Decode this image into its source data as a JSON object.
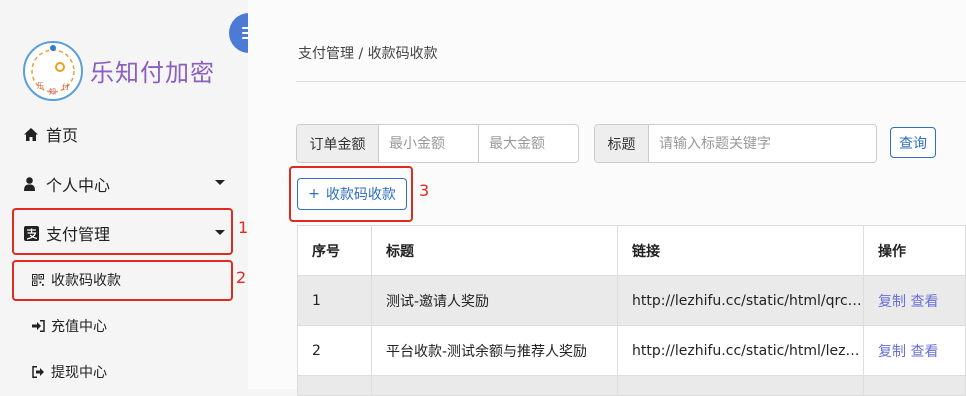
{
  "brand": {
    "name": "乐知付加密",
    "logo_text": [
      "乐",
      "知",
      "付"
    ]
  },
  "sidebar": {
    "items": [
      {
        "label": "首页",
        "icon": "home-icon"
      },
      {
        "label": "个人中心",
        "icon": "user-icon"
      },
      {
        "label": "支付管理",
        "icon": "alipay-icon"
      }
    ],
    "sub_items": [
      {
        "label": "收款码收款",
        "icon": "qrcode-icon"
      },
      {
        "label": "充值中心",
        "icon": "sign-in-icon"
      },
      {
        "label": "提现中心",
        "icon": "sign-out-icon"
      }
    ]
  },
  "annotations": [
    "1",
    "2",
    "3"
  ],
  "breadcrumb": "支付管理 / 收款码收款",
  "filters": {
    "amount_label": "订单金额",
    "min_placeholder": "最小金额",
    "max_placeholder": "最大金额",
    "title_label": "标题",
    "title_placeholder": "请输入标题关键字",
    "query_label": "查询"
  },
  "add_button": {
    "icon": "+",
    "label": "收款码收款"
  },
  "table": {
    "headers": [
      "序号",
      "标题",
      "链接",
      "操作"
    ],
    "rows": [
      {
        "id": "1",
        "title": "测试-邀请人奖励",
        "link": "http://lezhifu.cc/static/html/qrcode...",
        "copy": "复制",
        "view": "查看"
      },
      {
        "id": "2",
        "title": "平台收款-测试余额与推荐人奖励",
        "link": "http://lezhifu.cc/static/html/lezhip...",
        "copy": "复制",
        "view": "查看"
      }
    ]
  },
  "colors": {
    "accent": "#2f6fbd",
    "annotation": "#e0291f",
    "brand": "#8a5fc1"
  }
}
